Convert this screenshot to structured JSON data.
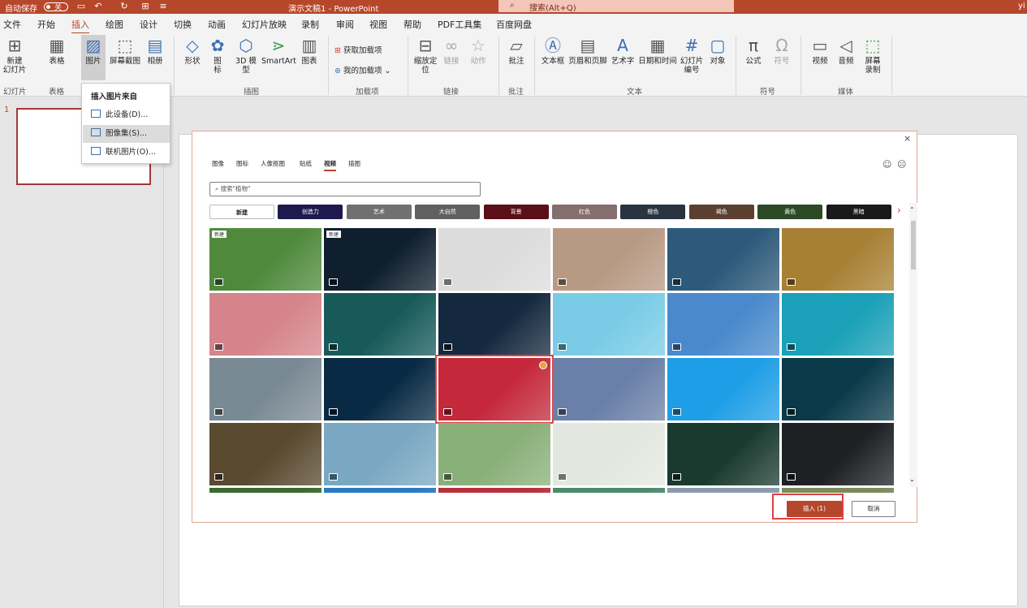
{
  "titlebar": {
    "autosave_label": "自动保存",
    "autosave_state": "关",
    "doc_title": "演示文稿1  -  PowerPoint",
    "search_placeholder": "搜索(Alt+Q)",
    "user": "yi"
  },
  "menu": [
    "文件",
    "开始",
    "插入",
    "绘图",
    "设计",
    "切换",
    "动画",
    "幻灯片放映",
    "录制",
    "审阅",
    "视图",
    "帮助",
    "PDF工具集",
    "百度网盘"
  ],
  "menu_active": "插入",
  "ribbon": {
    "new_slide": "新建\n幻灯片",
    "table": "表格",
    "picture": "图片",
    "screenshot": "屏幕截图",
    "album": "相册",
    "shapes": "形状",
    "icons": "图\n标",
    "model3d": "3D 模\n型",
    "smartart": "SmartArt",
    "chart": "图表",
    "get_addins": "获取加载项",
    "my_addins": "我的加载项",
    "zoom": "缩放定\n位",
    "link": "链接",
    "action": "动作",
    "comment": "批注",
    "textbox": "文本框",
    "header_footer": "页眉和页脚",
    "wordart": "艺术字",
    "datetime": "日期和时间",
    "slide_number": "幻灯片\n编号",
    "object": "对象",
    "equation": "公式",
    "symbol": "符号",
    "video": "视频",
    "audio": "音频",
    "screen_record": "屏幕\n录制",
    "groups": {
      "slides": "幻灯片",
      "tables": "表格",
      "illustrations": "插图",
      "addins": "加载项",
      "links": "链接",
      "comments": "批注",
      "text": "文本",
      "symbols": "符号",
      "media": "媒体"
    }
  },
  "dropdown": {
    "header": "插入图片来自",
    "items": [
      "此设备(D)...",
      "图像集(S)...",
      "联机图片(O)..."
    ]
  },
  "slides": {
    "number": "1"
  },
  "dialog": {
    "tabs": [
      "图像",
      "图标",
      "人像抠图",
      "贴纸",
      "视频",
      "插图"
    ],
    "active_tab": "视频",
    "search_placeholder": "搜索\"植物\"",
    "categories": [
      {
        "label": "新建",
        "color": "#ffffff"
      },
      {
        "label": "创造力",
        "color": "#1e1a4e"
      },
      {
        "label": "艺术",
        "color": "#707070"
      },
      {
        "label": "大自然",
        "color": "#606060"
      },
      {
        "label": "背景",
        "color": "#5a1016"
      },
      {
        "label": "红色",
        "color": "#856e6e"
      },
      {
        "label": "橙色",
        "color": "#2a3440"
      },
      {
        "label": "褐色",
        "color": "#5b4030"
      },
      {
        "label": "黄色",
        "color": "#2c4a26"
      },
      {
        "label": "黑暗",
        "color": "#1a1a1a"
      }
    ],
    "new_badge": "新建",
    "thumbnails": [
      [
        "#4f8a3c",
        "#0f1f2e",
        "#dcdcdc",
        "#b89a84",
        "#2d5a7a",
        "#a88034"
      ],
      [
        "#d4848a",
        "#185a5a",
        "#14283e",
        "#7acce6",
        "#4a8acc",
        "#1aa0b8"
      ],
      [
        "#7a8a94",
        "#082a44",
        "#c4283a",
        "#6a80a8",
        "#1e9ee6",
        "#0a3a4a"
      ],
      [
        "#5a4a30",
        "#7aa8c2",
        "#8ab07a",
        "#e2e8e0",
        "#1a3a30",
        "#1e2024"
      ],
      [
        "#3a6a2e",
        "#2a7ac0",
        "#b8303a",
        "#4c8a6a",
        "#8a9aaa",
        "#7a8a5a"
      ]
    ],
    "selected_index": [
      2,
      2
    ],
    "insert_label": "插入 (1)",
    "cancel_label": "取消",
    "close": "×"
  }
}
